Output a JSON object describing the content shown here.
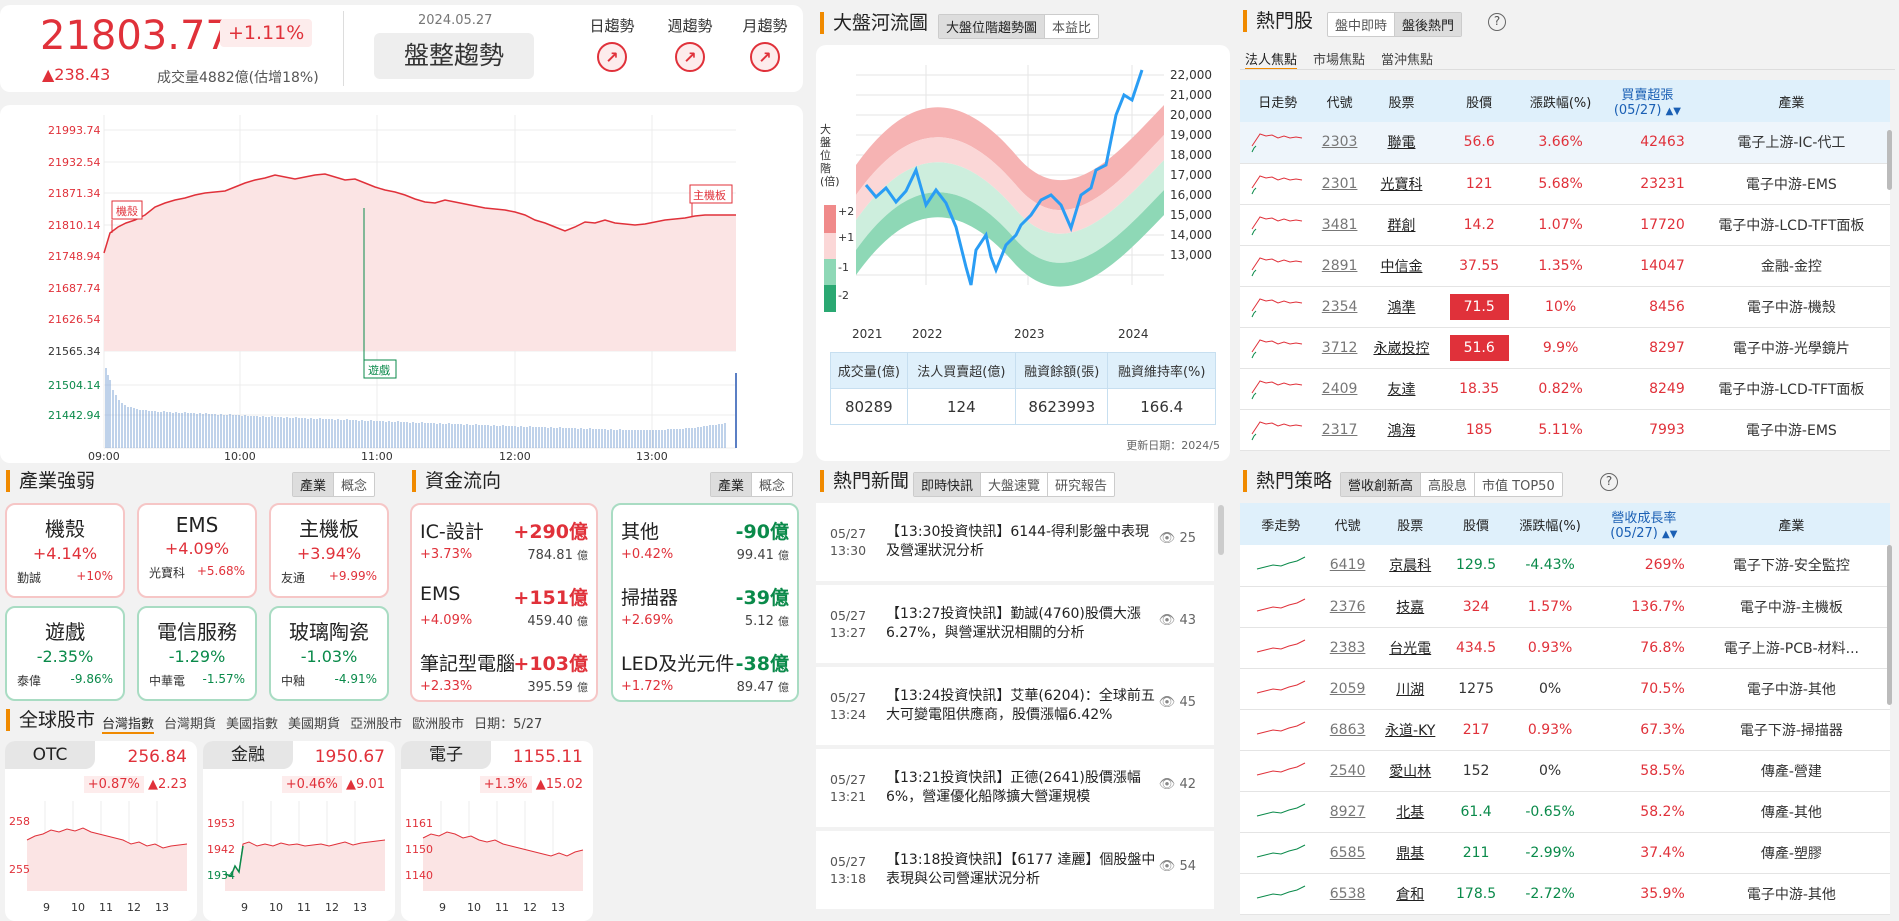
{
  "index": {
    "value": "21803.77",
    "pct": "+1.11%",
    "change": "▲238.43",
    "volume": "成交量4882億(估增18%)",
    "date": "2024.05.27",
    "status": "盤整趨勢",
    "trend_labels": [
      "日趨勢",
      "週趨勢",
      "月趨勢"
    ]
  },
  "intraday": {
    "y_ticks": [
      "21993.74",
      "21932.54",
      "21871.34",
      "21810.14",
      "21748.94",
      "21687.74",
      "21626.54",
      "21565.34"
    ],
    "vol_ticks": [
      "21504.14",
      "21442.94"
    ],
    "x_ticks": [
      "09:00",
      "10:00",
      "11:00",
      "12:00",
      "13:00"
    ],
    "markers": {
      "a": "機殼",
      "b": "主機板",
      "c": "遊戲"
    }
  },
  "river": {
    "title": "大盤河流圖",
    "tabs": [
      "大盤位階趨勢圖",
      "本益比"
    ],
    "vlabel": "大盤位階(倍)",
    "bands": [
      "+2",
      "+1",
      "-1",
      "-2"
    ],
    "y_ticks": [
      "22,000",
      "21,000",
      "20,000",
      "19,000",
      "18,000",
      "17,000",
      "16,000",
      "15,000",
      "14,000",
      "13,000"
    ],
    "x_ticks": [
      "2021",
      "2022",
      "2023",
      "2024"
    ],
    "table_head": [
      "成交量(億)",
      "法人買賣超(億)",
      "融資餘額(張)",
      "融資維持率(%)"
    ],
    "table_vals": [
      "80289",
      "124",
      "8623993",
      "166.4"
    ],
    "updated": "更新日期：2024/5"
  },
  "hot": {
    "title": "熱門股",
    "tabs": [
      "盤中即時",
      "盤後熱門"
    ],
    "help": "?",
    "subtabs": [
      "法人焦點",
      "市場焦點",
      "當沖焦點"
    ],
    "head": [
      "日走勢",
      "代號",
      "股票",
      "股價",
      "漲跌幅(%)",
      "買賣超張\n(05/27)",
      "產業"
    ],
    "rows": [
      [
        "2303",
        "聯電",
        "56.6",
        "3.66%",
        "42463",
        "電子上游-IC-代工"
      ],
      [
        "2301",
        "光寶科",
        "121",
        "5.68%",
        "23231",
        "電子中游-EMS"
      ],
      [
        "3481",
        "群創",
        "14.2",
        "1.07%",
        "17720",
        "電子中游-LCD-TFT面板"
      ],
      [
        "2891",
        "中信金",
        "37.55",
        "1.35%",
        "14047",
        "金融-金控"
      ],
      [
        "2354",
        "鴻準",
        "71.5",
        "10%",
        "8456",
        "電子中游-機殼"
      ],
      [
        "3712",
        "永崴投控",
        "51.6",
        "9.9%",
        "8297",
        "電子中游-光學鏡片"
      ],
      [
        "2409",
        "友達",
        "18.35",
        "0.82%",
        "8249",
        "電子中游-LCD-TFT面板"
      ],
      [
        "2317",
        "鴻海",
        "185",
        "5.11%",
        "7993",
        "電子中游-EMS"
      ]
    ]
  },
  "industry": {
    "title": "產業強弱",
    "tabs": [
      "產業",
      "概念"
    ],
    "cards": [
      {
        "name": "機殼",
        "pct": "+4.14%",
        "stock": "勤誠",
        "sp": "+10%"
      },
      {
        "name": "EMS",
        "pct": "+4.09%",
        "stock": "光寶科",
        "sp": "+5.68%"
      },
      {
        "name": "主機板",
        "pct": "+3.94%",
        "stock": "友通",
        "sp": "+9.99%"
      },
      {
        "name": "遊戲",
        "pct": "-2.35%",
        "stock": "泰偉",
        "sp": "-9.86%"
      },
      {
        "name": "電信服務",
        "pct": "-1.29%",
        "stock": "中華電",
        "sp": "-1.57%"
      },
      {
        "name": "玻璃陶瓷",
        "pct": "-1.03%",
        "stock": "中釉",
        "sp": "-4.91%"
      }
    ]
  },
  "flow": {
    "title": "資金流向",
    "tabs": [
      "產業",
      "概念"
    ],
    "unit": "億",
    "left": [
      {
        "name": "IC-設計",
        "val": "+290億",
        "pct": "+3.73%",
        "amt": "784.81"
      },
      {
        "name": "EMS",
        "val": "+151億",
        "pct": "+4.09%",
        "amt": "459.40"
      },
      {
        "name": "筆記型電腦",
        "val": "+103億",
        "pct": "+2.33%",
        "amt": "395.59"
      }
    ],
    "right": [
      {
        "name": "其他",
        "val": "-90億",
        "pct": "+0.42%",
        "amt": "99.41"
      },
      {
        "name": "掃描器",
        "val": "-39億",
        "pct": "+2.69%",
        "amt": "5.12"
      },
      {
        "name": "LED及光元件",
        "val": "-38億",
        "pct": "+1.72%",
        "amt": "89.47"
      }
    ]
  },
  "global": {
    "title": "全球股市",
    "tabs": [
      "台灣指數",
      "台灣期貨",
      "美國指數",
      "美國期貨",
      "亞洲股市",
      "歐洲股市"
    ],
    "date": "日期：5/27",
    "x_ticks": [
      "9",
      "10",
      "11",
      "12",
      "13"
    ],
    "minis": [
      {
        "name": "OTC",
        "val": "256.84",
        "pct": "+0.87%",
        "chg": "▲2.23",
        "yt": [
          "258",
          "255"
        ]
      },
      {
        "name": "金融",
        "val": "1950.67",
        "pct": "+0.46%",
        "chg": "▲9.01",
        "yt": [
          "1953",
          "1942",
          "1934"
        ]
      },
      {
        "name": "電子",
        "val": "1155.11",
        "pct": "+1.3%",
        "chg": "▲15.02",
        "yt": [
          "1161",
          "1150",
          "1140"
        ]
      }
    ]
  },
  "news": {
    "title": "熱門新聞",
    "tabs": [
      "即時快訊",
      "大盤速覽",
      "研究報告"
    ],
    "items": [
      {
        "date": "05/27",
        "time": "13:30",
        "text": "【13:30投資快訊】6144-得利影盤中表現及營運狀況分析",
        "views": "25"
      },
      {
        "date": "05/27",
        "time": "13:27",
        "text": "【13:27投資快訊】勤誠(4760)股價大漲6.27%，與營運狀況相關的分析",
        "views": "43"
      },
      {
        "date": "05/27",
        "time": "13:24",
        "text": "【13:24投資快訊】艾華(6204)：全球前五大可變電阻供應商，股價漲幅6.42%",
        "views": "45"
      },
      {
        "date": "05/27",
        "time": "13:21",
        "text": "【13:21投資快訊】正德(2641)股價漲幅6%，營運優化船隊擴大營運規模",
        "views": "42"
      },
      {
        "date": "05/27",
        "time": "13:18",
        "text": "【13:18投資快訊】【6177 達麗】個股盤中表現與公司營運狀況分析",
        "views": "54"
      }
    ]
  },
  "strategy": {
    "title": "熱門策略",
    "tabs": [
      "營收創新高",
      "高股息",
      "市值 TOP50"
    ],
    "help": "?",
    "head": [
      "季走勢",
      "代號",
      "股票",
      "股價",
      "漲跌幅(%)",
      "營收成長率\n(05/27)",
      "產業"
    ],
    "rows": [
      [
        "6419",
        "京晨科",
        "129.5",
        "-4.43%",
        "269%",
        "電子下游-安全監控"
      ],
      [
        "2376",
        "技嘉",
        "324",
        "1.57%",
        "136.7%",
        "電子中游-主機板"
      ],
      [
        "2383",
        "台光電",
        "434.5",
        "0.93%",
        "76.8%",
        "電子上游-PCB-材料..."
      ],
      [
        "2059",
        "川湖",
        "1275",
        "0%",
        "70.5%",
        "電子中游-其他"
      ],
      [
        "6863",
        "永道-KY",
        "217",
        "0.93%",
        "67.3%",
        "電子下游-掃描器"
      ],
      [
        "2540",
        "愛山林",
        "152",
        "0%",
        "58.5%",
        "傳產-營建"
      ],
      [
        "8927",
        "北基",
        "61.4",
        "-0.65%",
        "58.2%",
        "傳產-其他"
      ],
      [
        "6585",
        "鼎基",
        "211",
        "-2.99%",
        "37.4%",
        "傳產-塑膠"
      ],
      [
        "6538",
        "倉和",
        "178.5",
        "-2.72%",
        "35.9%",
        "電子中游-其他"
      ]
    ]
  }
}
